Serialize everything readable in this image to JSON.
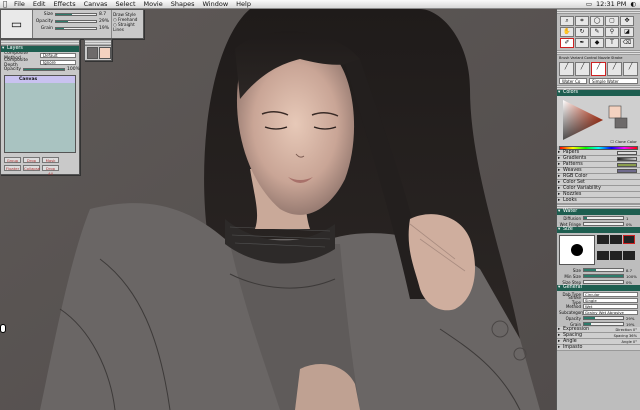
{
  "menubar": {
    "items": [
      "File",
      "Edit",
      "Effects",
      "Canvas",
      "Select",
      "Movie",
      "Shapes",
      "Window",
      "Help"
    ],
    "clock": "12:31 PM"
  },
  "top_palette": {
    "rows": [
      {
        "label": "Size",
        "value": "8.7"
      },
      {
        "label": "Opacity",
        "value": "29%"
      },
      {
        "label": "Grain",
        "value": "19%"
      }
    ],
    "draw_style_label": "Draw Style",
    "options": [
      "Freehand",
      "Straight Lines"
    ]
  },
  "layers": {
    "title": "Layers",
    "composite_method_label": "Composite Method",
    "composite_method_value": "Default",
    "composite_depth_label": "Composite Depth",
    "composite_depth_value": "Ignore",
    "opacity_label": "Opacity",
    "opacity_value": "100%",
    "layer_name": "Canvas",
    "buttons": [
      "Group",
      "Drop",
      "Mask",
      "Floater",
      "Collapse",
      "Drop All"
    ]
  },
  "right_panel": {
    "brush_tabs": [
      "Brush",
      "Variant",
      "Control",
      "Nozzle",
      "Stroke"
    ],
    "category": "Water Co",
    "variant": "Simple Water",
    "colors_header": "Colors",
    "clone_color_label": "Clone Color",
    "collapsed_sections": [
      "Papers",
      "Gradients",
      "Patterns",
      "Weaves",
      "RGB Color",
      "Color Set",
      "Color Variability",
      "Nozzles",
      "Looks"
    ],
    "water": {
      "header": "Water",
      "rows": [
        {
          "label": "Diffusion",
          "value": "1"
        },
        {
          "label": "Wet Fringe",
          "value": "0%"
        }
      ]
    },
    "size": {
      "header": "Size",
      "rows": [
        {
          "label": "Size",
          "value": "8.7"
        },
        {
          "label": "Min Size",
          "value": "100%"
        },
        {
          "label": "Size Step",
          "value": "0%"
        }
      ]
    },
    "general": {
      "header": "General",
      "rows": [
        {
          "label": "Dab Type",
          "value": "Circular"
        },
        {
          "label": "Stroke Type",
          "value": "Single"
        },
        {
          "label": "Method",
          "value": "Wet"
        },
        {
          "label": "Subcategory",
          "value": "Grainy Wet Abrasive"
        },
        {
          "label": "Opacity",
          "value": "29%"
        },
        {
          "label": "Grain",
          "value": "19%"
        }
      ]
    },
    "bottom_sections": [
      {
        "label": "Expression",
        "value": "Direction 0°"
      },
      {
        "label": "Spacing",
        "value": "Spacing 36%"
      },
      {
        "label": "Angle",
        "value": "Angle 0°"
      },
      {
        "label": "Impasto",
        "value": ""
      }
    ]
  },
  "colors": {
    "menubar_bg": "#e6e6e6",
    "panel_header": "#1e5e50",
    "slider_fill": "#2e7b6b",
    "canvas_bg": "#5a5554",
    "current_color": "#f4d2c0"
  }
}
